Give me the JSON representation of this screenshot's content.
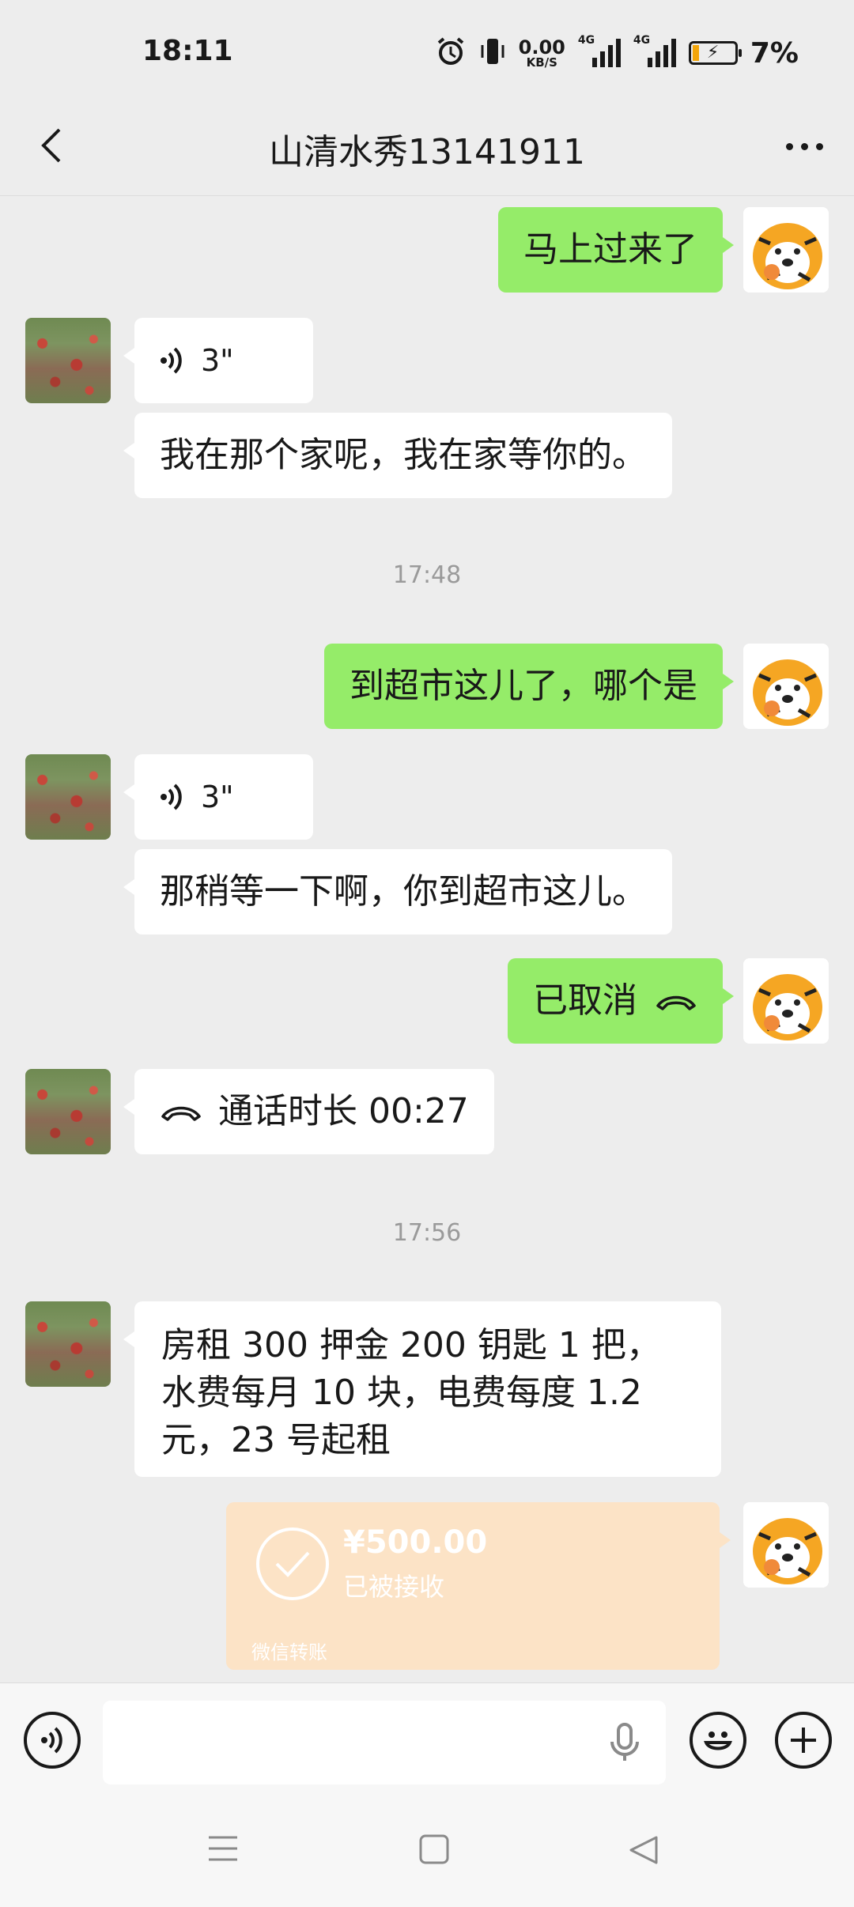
{
  "status": {
    "time": "18:11",
    "net_speed": "0.00",
    "net_unit": "KB/S",
    "sim1": "4G",
    "sim2": "4G",
    "battery": "7%"
  },
  "header": {
    "title": "山清水秀13141911"
  },
  "messages": {
    "m1": "马上过来了",
    "m2_duration": "3\"",
    "m3": "我在那个家呢，我在家等你的。",
    "t1": "17:48",
    "m4": "到超市这儿了，哪个是",
    "m5_duration": "3\"",
    "m6": "那稍等一下啊，你到超市这儿。",
    "m7": "已取消",
    "m8": "通话时长 00:27",
    "t2": "17:56",
    "m9": "房租 300 押金 200 钥匙 1 把，水费每月 10 块，电费每度 1.2 元，23 号起租"
  },
  "transfer": {
    "amount": "¥500.00",
    "status": "已被接收",
    "label": "微信转账"
  },
  "colors": {
    "sent_bubble": "#95ec69",
    "received_bubble": "#ffffff",
    "background": "#ededed",
    "transfer": "#fce3c6",
    "battery_low": "#f2a50a"
  }
}
